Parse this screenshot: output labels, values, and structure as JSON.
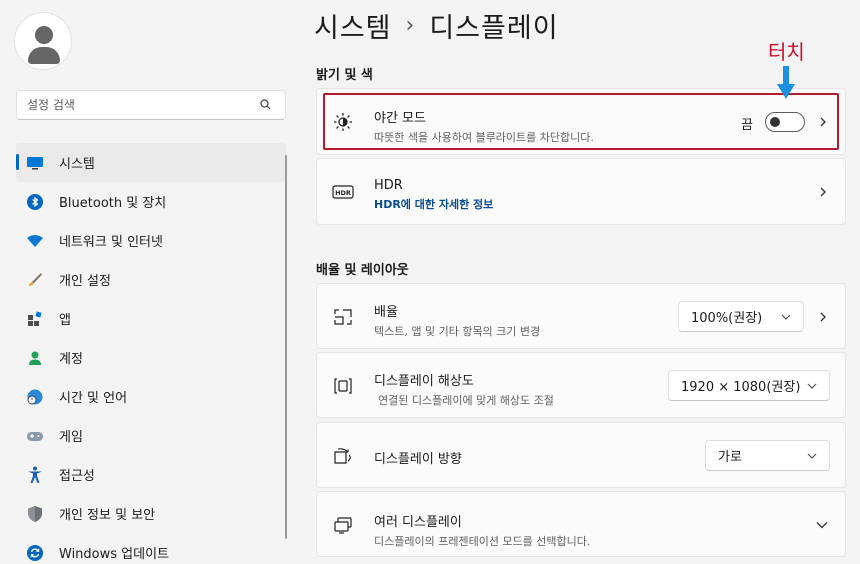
{
  "breadcrumb": {
    "parent": "시스템",
    "separator": "›",
    "current": "디스플레이"
  },
  "search": {
    "placeholder": "설정 검색"
  },
  "nav": {
    "items": [
      {
        "label": "시스템",
        "icon": "system-icon",
        "active": true
      },
      {
        "label": "Bluetooth 및 장치",
        "icon": "bluetooth-icon"
      },
      {
        "label": "네트워크 및 인터넷",
        "icon": "wifi-icon"
      },
      {
        "label": "개인 설정",
        "icon": "brush-icon"
      },
      {
        "label": "앱",
        "icon": "apps-icon"
      },
      {
        "label": "계정",
        "icon": "account-icon"
      },
      {
        "label": "시간 및 언어",
        "icon": "globe-clock-icon"
      },
      {
        "label": "게임",
        "icon": "gamepad-icon"
      },
      {
        "label": "접근성",
        "icon": "accessibility-icon"
      },
      {
        "label": "개인 정보 및 보안",
        "icon": "shield-icon"
      },
      {
        "label": "Windows 업데이트",
        "icon": "update-icon"
      }
    ]
  },
  "sections": {
    "brightness": "밝기 및 색",
    "scale_layout": "배율 및 레이아웃"
  },
  "night_light": {
    "title": "야간 모드",
    "desc": "따뜻한 색을 사용하여 블루라이트를 차단합니다.",
    "state_label": "끔",
    "on": false
  },
  "hdr": {
    "title": "HDR",
    "link": "HDR에 대한 자세한 정보"
  },
  "scale": {
    "title": "배율",
    "desc": "텍스트, 앱 및 기타 항목의 크기 변경",
    "value": "100%(권장)"
  },
  "resolution": {
    "title": "디스플레이 해상도",
    "desc": "연결된 디스플레이에 맞게 해상도 조절",
    "value": "1920 × 1080(권장)"
  },
  "orientation": {
    "title": "디스플레이 방향",
    "value": "가로"
  },
  "multi": {
    "title": "여러 디스플레이",
    "desc": "디스플레이의 프레젠테이션 모드를 선택합니다."
  },
  "annotation": {
    "label": "터치",
    "color": "#c8102e",
    "arrow_color": "#1e90e0"
  },
  "colors": {
    "accent": "#0067c0",
    "highlight_border": "#b01c2e"
  }
}
